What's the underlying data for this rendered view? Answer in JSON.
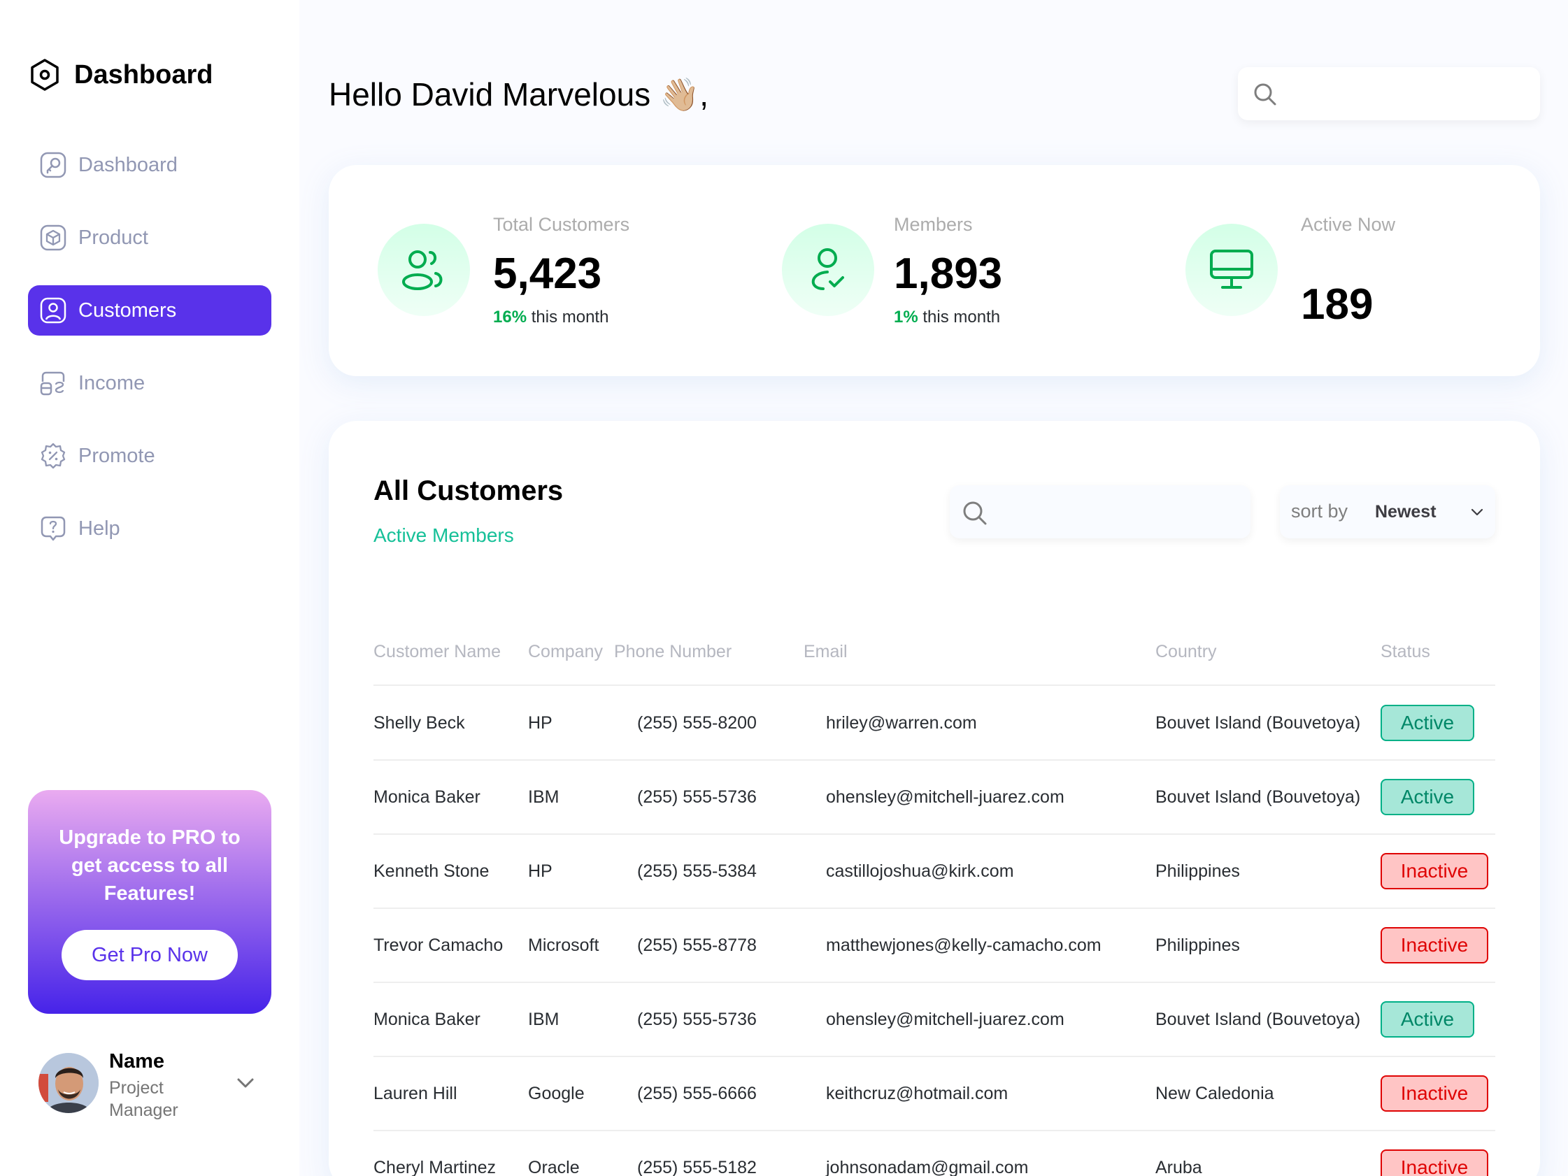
{
  "brand": {
    "title": "Dashboard"
  },
  "sidebar": {
    "items": [
      {
        "label": "Dashboard",
        "icon": "key-square-icon",
        "active": false
      },
      {
        "label": "Product",
        "icon": "cube-icon",
        "active": false
      },
      {
        "label": "Customers",
        "icon": "user-square-icon",
        "active": true
      },
      {
        "label": "Income",
        "icon": "wallet-money-icon",
        "active": false
      },
      {
        "label": "Promote",
        "icon": "discount-shape-icon",
        "active": false
      },
      {
        "label": "Help",
        "icon": "message-question-icon",
        "active": false
      }
    ]
  },
  "promo": {
    "text": "Upgrade to PRO to get access to all Features!",
    "button_label": "Get Pro Now"
  },
  "profile": {
    "name": "Name",
    "role": "Project Manager"
  },
  "header": {
    "greeting": "Hello David Marvelous 👋🏼,",
    "search_placeholder": ""
  },
  "stats": [
    {
      "label": "Total Customers",
      "value": "5,423",
      "change_pct": "16%",
      "change_text": "this month",
      "icon": "users-icon"
    },
    {
      "label": "Members",
      "value": "1,893",
      "change_pct": "1%",
      "change_text": "this month",
      "icon": "user-check-icon"
    },
    {
      "label": "Active Now",
      "value": "189",
      "icon": "monitor-icon"
    }
  ],
  "customers": {
    "title": "All Customers",
    "subtitle": "Active Members",
    "search_placeholder": "",
    "sort_label": "sort by",
    "sort_value": "Newest",
    "columns": [
      "Customer Name",
      "Company",
      "Phone Number",
      "Email",
      "Country",
      "Status"
    ],
    "rows": [
      {
        "name": "Shelly Beck",
        "company": "HP",
        "phone": "(255) 555-8200",
        "email": "hriley@warren.com",
        "country": "Bouvet Island (Bouvetoya)",
        "status": "Active"
      },
      {
        "name": "Monica Baker",
        "company": "IBM",
        "phone": "(255) 555-5736",
        "email": "ohensley@mitchell-juarez.com",
        "country": "Bouvet Island (Bouvetoya)",
        "status": "Active"
      },
      {
        "name": "Kenneth Stone",
        "company": "HP",
        "phone": "(255) 555-5384",
        "email": "castillojoshua@kirk.com",
        "country": "Philippines",
        "status": "Inactive"
      },
      {
        "name": "Trevor Camacho",
        "company": "Microsoft",
        "phone": "(255) 555-8778",
        "email": "matthewjones@kelly-camacho.com",
        "country": "Philippines",
        "status": "Inactive"
      },
      {
        "name": "Monica Baker",
        "company": "IBM",
        "phone": "(255) 555-5736",
        "email": "ohensley@mitchell-juarez.com",
        "country": "Bouvet Island (Bouvetoya)",
        "status": "Active"
      },
      {
        "name": "Lauren Hill",
        "company": "Google",
        "phone": "(255) 555-6666",
        "email": "keithcruz@hotmail.com",
        "country": "New Caledonia",
        "status": "Inactive"
      },
      {
        "name": "Cheryl Martinez",
        "company": "Oracle",
        "phone": "(255) 555-5182",
        "email": "johnsonadam@gmail.com",
        "country": "Aruba",
        "status": "Inactive"
      }
    ]
  },
  "colors": {
    "accent": "#5932ea",
    "positive": "#00ac4f",
    "active_badge": "#008767",
    "inactive_badge": "#df0404"
  }
}
